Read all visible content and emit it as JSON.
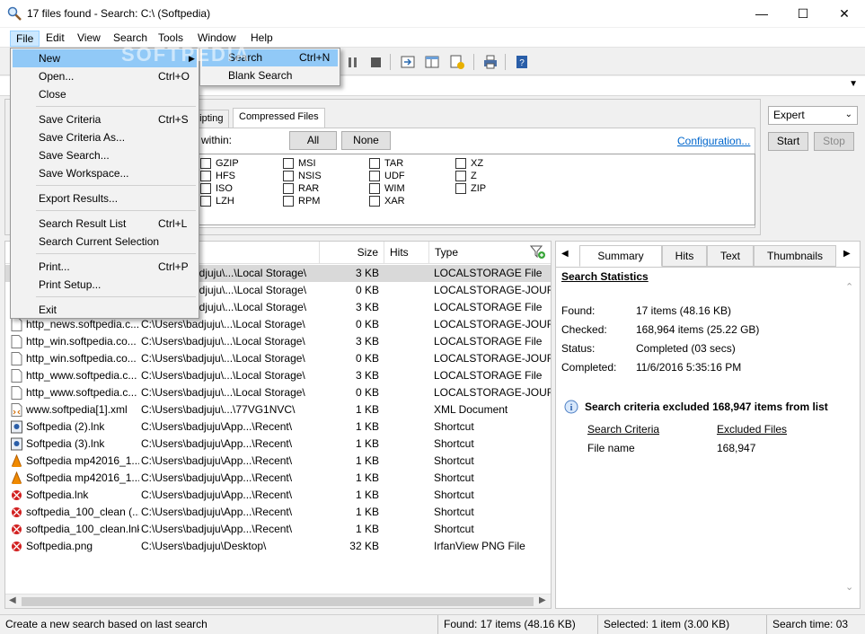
{
  "window": {
    "title": "17 files found - Search: C:\\ (Softpedia)",
    "minimize": "—",
    "maximize": "☐",
    "close": "✕"
  },
  "menubar": [
    "File",
    "Edit",
    "View",
    "Search",
    "Tools",
    "Window",
    "Help"
  ],
  "file_menu": {
    "items": [
      {
        "label": "New",
        "shortcut": "",
        "submenu": true
      },
      {
        "label": "Open...",
        "shortcut": "Ctrl+O"
      },
      {
        "label": "Close",
        "shortcut": ""
      },
      {
        "label": "Save Criteria",
        "shortcut": "Ctrl+S"
      },
      {
        "label": "Save Criteria As...",
        "shortcut": ""
      },
      {
        "label": "Save Search...",
        "shortcut": ""
      },
      {
        "label": "Save Workspace...",
        "shortcut": ""
      },
      {
        "label": "Export Results...",
        "shortcut": ""
      },
      {
        "label": "Search Result List",
        "shortcut": "Ctrl+L"
      },
      {
        "label": "Search Current Selection",
        "shortcut": ""
      },
      {
        "label": "Print...",
        "shortcut": "Ctrl+P"
      },
      {
        "label": "Print Setup...",
        "shortcut": ""
      },
      {
        "label": "Exit",
        "shortcut": ""
      }
    ],
    "submenu": [
      {
        "label": "Search",
        "shortcut": "Ctrl+N"
      },
      {
        "label": "Blank Search",
        "shortcut": ""
      }
    ]
  },
  "criteria": {
    "tabs": [
      "cripting",
      "Compressed Files"
    ],
    "within_label": "within:",
    "all_button": "All",
    "none_button": "None",
    "configuration_link": "Configuration...",
    "formats": [
      [
        "GZIP",
        "MSI",
        "TAR",
        "XZ"
      ],
      [
        "HFS",
        "NSIS",
        "UDF",
        "Z"
      ],
      [
        "ISO",
        "RAR",
        "WIM",
        "ZIP"
      ],
      [
        "LZH",
        "RPM",
        "XAR",
        ""
      ]
    ],
    "mode_select": "Expert",
    "start_button": "Start",
    "stop_button": "Stop"
  },
  "results": {
    "columns": [
      "Size",
      "Hits",
      "Type"
    ],
    "rows": [
      {
        "name": "",
        "path": "jdjuju\\...\\Local Storage\\",
        "size": "3 KB",
        "type": "LOCALSTORAGE File",
        "icon": "doc"
      },
      {
        "name": "",
        "path": "jdjuju\\...\\Local Storage\\",
        "size": "0 KB",
        "type": "LOCALSTORAGE-JOURN",
        "icon": "doc"
      },
      {
        "name": "",
        "path": "jdjuju\\...\\Local Storage\\",
        "size": "3 KB",
        "type": "LOCALSTORAGE File",
        "icon": "doc"
      },
      {
        "name": "http_news.softpedia.c...",
        "path": "C:\\Users\\badjuju\\...\\Local Storage\\",
        "size": "0 KB",
        "type": "LOCALSTORAGE-JOURN",
        "icon": "doc"
      },
      {
        "name": "http_win.softpedia.co...",
        "path": "C:\\Users\\badjuju\\...\\Local Storage\\",
        "size": "3 KB",
        "type": "LOCALSTORAGE File",
        "icon": "doc"
      },
      {
        "name": "http_win.softpedia.co...",
        "path": "C:\\Users\\badjuju\\...\\Local Storage\\",
        "size": "0 KB",
        "type": "LOCALSTORAGE-JOURN",
        "icon": "doc"
      },
      {
        "name": "http_www.softpedia.c...",
        "path": "C:\\Users\\badjuju\\...\\Local Storage\\",
        "size": "3 KB",
        "type": "LOCALSTORAGE File",
        "icon": "doc"
      },
      {
        "name": "http_www.softpedia.c...",
        "path": "C:\\Users\\badjuju\\...\\Local Storage\\",
        "size": "0 KB",
        "type": "LOCALSTORAGE-JOURN",
        "icon": "doc"
      },
      {
        "name": "www.softpedia[1].xml",
        "path": "C:\\Users\\badjuju\\...\\77VG1NVC\\",
        "size": "1 KB",
        "type": "XML Document",
        "icon": "xml"
      },
      {
        "name": "Softpedia (2).lnk",
        "path": "C:\\Users\\badjuju\\App...\\Recent\\",
        "size": "1 KB",
        "type": "Shortcut",
        "icon": "lnk"
      },
      {
        "name": "Softpedia (3).lnk",
        "path": "C:\\Users\\badjuju\\App...\\Recent\\",
        "size": "1 KB",
        "type": "Shortcut",
        "icon": "lnk"
      },
      {
        "name": "Softpedia mp42016_1...",
        "path": "C:\\Users\\badjuju\\App...\\Recent\\",
        "size": "1 KB",
        "type": "Shortcut",
        "icon": "vlc"
      },
      {
        "name": "Softpedia mp42016_1...",
        "path": "C:\\Users\\badjuju\\App...\\Recent\\",
        "size": "1 KB",
        "type": "Shortcut",
        "icon": "vlc"
      },
      {
        "name": "Softpedia.lnk",
        "path": "C:\\Users\\badjuju\\App...\\Recent\\",
        "size": "1 KB",
        "type": "Shortcut",
        "icon": "irfan"
      },
      {
        "name": "softpedia_100_clean (...",
        "path": "C:\\Users\\badjuju\\App...\\Recent\\",
        "size": "1 KB",
        "type": "Shortcut",
        "icon": "irfan"
      },
      {
        "name": "softpedia_100_clean.lnk",
        "path": "C:\\Users\\badjuju\\App...\\Recent\\",
        "size": "1 KB",
        "type": "Shortcut",
        "icon": "irfan"
      },
      {
        "name": "Softpedia.png",
        "path": "C:\\Users\\badjuju\\Desktop\\",
        "size": "32 KB",
        "type": "IrfanView PNG File",
        "icon": "irfan"
      }
    ]
  },
  "preview": {
    "tabs": [
      "Summary",
      "Hits",
      "Text",
      "Thumbnails"
    ],
    "heading": "Search Statistics",
    "stats": [
      {
        "label": "Found:",
        "value": "17 items (48.16 KB)"
      },
      {
        "label": "Checked:",
        "value": "168,964 items (25.22 GB)"
      },
      {
        "label": "Status:",
        "value": "Completed (03 secs)"
      },
      {
        "label": "Completed:",
        "value": "11/6/2016 5:35:16 PM"
      }
    ],
    "excluded_note": "Search criteria excluded 168,947 items from list",
    "excluded_headers": [
      "Search Criteria",
      "Excluded Files"
    ],
    "excluded_row": {
      "criteria": "File name",
      "count": "168,947"
    }
  },
  "statusbar": {
    "hint": "Create a new search based on last search",
    "found": "Found: 17 items (48.16 KB)",
    "selected": "Selected: 1 item (3.00 KB)",
    "time": "Search time: 03"
  },
  "watermark": "SOFTPEDIA"
}
